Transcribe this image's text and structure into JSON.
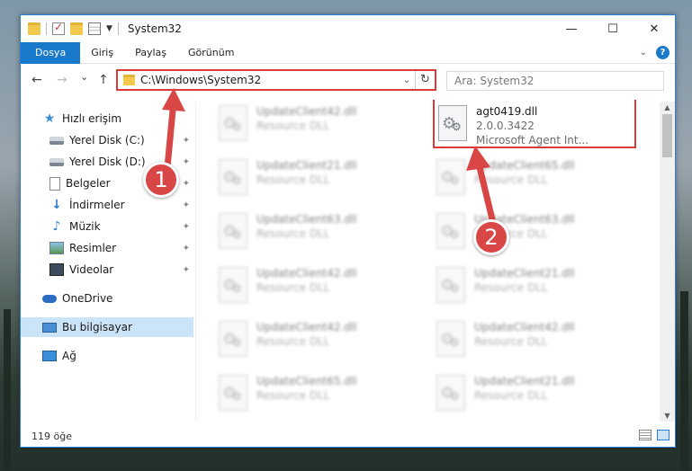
{
  "window": {
    "title": "System32",
    "controls": {
      "minimize": "—",
      "maximize": "☐",
      "close": "✕"
    }
  },
  "ribbon": {
    "tabs": [
      {
        "label": "Dosya",
        "active": true
      },
      {
        "label": "Giriş"
      },
      {
        "label": "Paylaş"
      },
      {
        "label": "Görünüm"
      }
    ],
    "help": "?"
  },
  "nav": {
    "back": "←",
    "forward": "→",
    "recent": "⌄",
    "up": "↑",
    "address": "C:\\Windows\\System32",
    "search_placeholder": "Ara: System32"
  },
  "sidebar": {
    "items": [
      {
        "label": "Hızlı erişim",
        "icon": "star-icon"
      },
      {
        "label": "Yerel Disk (C:)",
        "icon": "disk-icon",
        "pinned": true
      },
      {
        "label": "Yerel Disk (D:)",
        "icon": "disk-icon",
        "pinned": true
      },
      {
        "label": "Belgeler",
        "icon": "document-icon",
        "pinned": true
      },
      {
        "label": "İndirmeler",
        "icon": "download-icon",
        "pinned": true
      },
      {
        "label": "Müzik",
        "icon": "music-icon",
        "pinned": true
      },
      {
        "label": "Resimler",
        "icon": "pictures-icon",
        "pinned": true
      },
      {
        "label": "Videolar",
        "icon": "videos-icon",
        "pinned": true
      },
      {
        "label": "OneDrive",
        "icon": "onedrive-icon"
      },
      {
        "label": "Bu bilgisayar",
        "icon": "computer-icon",
        "selected": true
      },
      {
        "label": "Ağ",
        "icon": "network-icon"
      }
    ]
  },
  "files": {
    "left": [
      {
        "name": "UpdateClient42.dll",
        "type": "Resource DLL"
      },
      {
        "name": "UpdateClient21.dll",
        "type": "Resource DLL"
      },
      {
        "name": "UpdateClient63.dll",
        "type": "Resource DLL"
      },
      {
        "name": "UpdateClient42.dll",
        "type": "Resource DLL"
      },
      {
        "name": "UpdateClient42.dll",
        "type": "Resource DLL"
      },
      {
        "name": "UpdateClient65.dll",
        "type": "Resource DLL"
      }
    ],
    "right": [
      {
        "name": "agt0419.dll",
        "version": "2.0.0.3422",
        "description": "Microsoft Agent Int...",
        "highlighted": true
      },
      {
        "name": "UpdateClient65.dll",
        "type": "Resource DLL"
      },
      {
        "name": "UpdateClient63.dll",
        "type": "Resource DLL"
      },
      {
        "name": "UpdateClient21.dll",
        "type": "Resource DLL"
      },
      {
        "name": "UpdateClient42.dll",
        "type": "Resource DLL"
      },
      {
        "name": "UpdateClient21.dll",
        "type": "Resource DLL"
      }
    ]
  },
  "status": {
    "count": "119 öğe"
  },
  "annotations": {
    "badge1": "1",
    "badge2": "2",
    "color": "#d94646"
  }
}
